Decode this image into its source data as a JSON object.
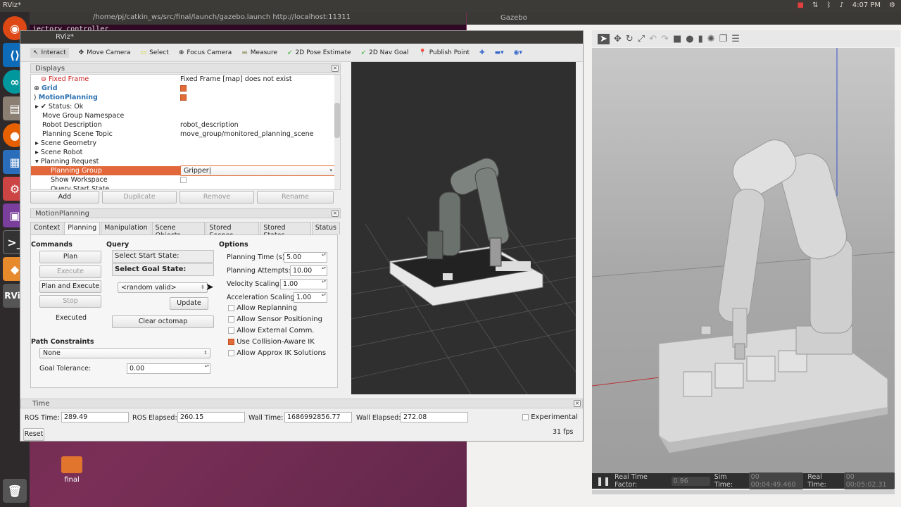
{
  "system": {
    "app_title": "RViz*",
    "clock": "4:07 PM"
  },
  "terminal": {
    "title": "/home/pj/catkin_ws/src/final/launch/gazebo.launch http://localhost:11311",
    "line": "jectory controller"
  },
  "gazebo": {
    "title": "Gazebo",
    "rtf_label": "Real Time Factor:",
    "rtf_value": "0.96",
    "sim_label": "Sim Time:",
    "sim_value": "00 00:04:49.460",
    "real_label": "Real Time:",
    "real_value": "00 00:05:02.31"
  },
  "desktop": {
    "folder_label": "final"
  },
  "rviz": {
    "title": "RViz*",
    "toolbar": [
      "Interact",
      "Move Camera",
      "Select",
      "Focus Camera",
      "Measure",
      "2D Pose Estimate",
      "2D Nav Goal",
      "Publish Point"
    ],
    "displays": {
      "header": "Displays",
      "rows": [
        {
          "label": "Fixed Frame",
          "value": "Fixed Frame [map] does not exist"
        },
        {
          "label": "Grid",
          "value": ""
        },
        {
          "label": "MotionPlanning",
          "value": ""
        },
        {
          "label": "Status: Ok",
          "value": ""
        },
        {
          "label": "Move Group Namespace",
          "value": ""
        },
        {
          "label": "Robot Description",
          "value": "robot_description"
        },
        {
          "label": "Planning Scene Topic",
          "value": "move_group/monitored_planning_scene"
        },
        {
          "label": "Scene Geometry",
          "value": ""
        },
        {
          "label": "Scene Robot",
          "value": ""
        },
        {
          "label": "Planning Request",
          "value": ""
        },
        {
          "label": "Planning Group",
          "value": "Gripper|"
        },
        {
          "label": "Show Workspace",
          "value": ""
        },
        {
          "label": "Query Start State",
          "value": ""
        }
      ],
      "buttons": [
        "Add",
        "Duplicate",
        "Remove",
        "Rename"
      ]
    },
    "motion_planning": {
      "header": "MotionPlanning",
      "tabs": [
        "Context",
        "Planning",
        "Manipulation",
        "Scene Objects",
        "Stored Scenes",
        "Stored States",
        "Status"
      ],
      "commands_label": "Commands",
      "plan": "Plan",
      "execute": "Execute",
      "plan_execute": "Plan and Execute",
      "stop": "Stop",
      "status": "Executed",
      "query_label": "Query",
      "start_state": "Select Start State:",
      "goal_state": "Select Goal State:",
      "goal_option": "<random valid>",
      "update": "Update",
      "clear_octomap": "Clear octomap",
      "options_label": "Options",
      "planning_time_label": "Planning Time (s):",
      "planning_time": "5.00",
      "planning_attempts_label": "Planning Attempts:",
      "planning_attempts": "10.00",
      "velocity_label": "Velocity Scaling:",
      "velocity": "1.00",
      "accel_label": "Acceleration Scaling:",
      "accel": "1.00",
      "checks": [
        {
          "label": "Allow Replanning",
          "checked": false
        },
        {
          "label": "Allow Sensor Positioning",
          "checked": false
        },
        {
          "label": "Allow External Comm.",
          "checked": false
        },
        {
          "label": "Use Collision-Aware IK",
          "checked": true
        },
        {
          "label": "Allow Approx IK Solutions",
          "checked": false
        }
      ],
      "path_constraints_label": "Path Constraints",
      "path_constraints": "None",
      "goal_tolerance_label": "Goal Tolerance:",
      "goal_tolerance": "0.00"
    },
    "time": {
      "header": "Time",
      "ros_time_label": "ROS Time:",
      "ros_time": "289.49",
      "ros_elapsed_label": "ROS Elapsed:",
      "ros_elapsed": "260.15",
      "wall_time_label": "Wall Time:",
      "wall_time": "1686992856.77",
      "wall_elapsed_label": "Wall Elapsed:",
      "wall_elapsed": "272.08",
      "experimental": "Experimental",
      "reset": "Reset",
      "fps": "31 fps"
    }
  }
}
